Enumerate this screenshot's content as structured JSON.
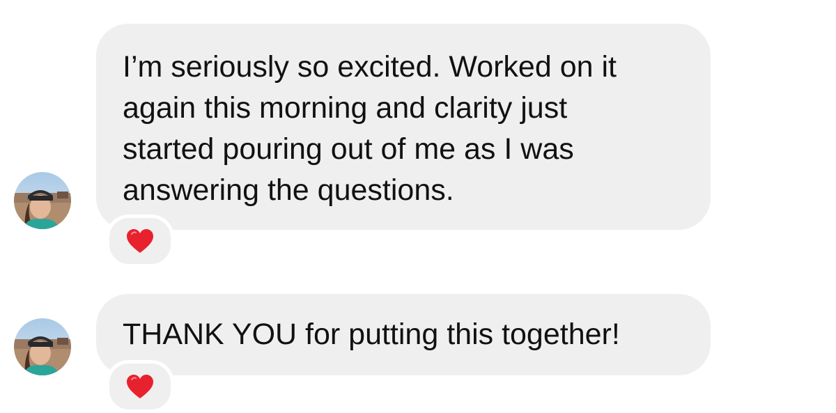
{
  "messages": [
    {
      "text": "I’m seriously so excited. Worked on it\nagain this morning and clarity just\nstarted pouring out of me as I was\nanswering the questions.",
      "reaction_icon": "heart-icon",
      "avatar_icon": "avatar-photo"
    },
    {
      "text": "THANK YOU for putting this together!",
      "reaction_icon": "heart-icon",
      "avatar_icon": "avatar-photo"
    }
  ],
  "colors": {
    "bubble": "#efefef",
    "text": "#111111",
    "heart": "#e8212e",
    "background": "#ffffff"
  }
}
